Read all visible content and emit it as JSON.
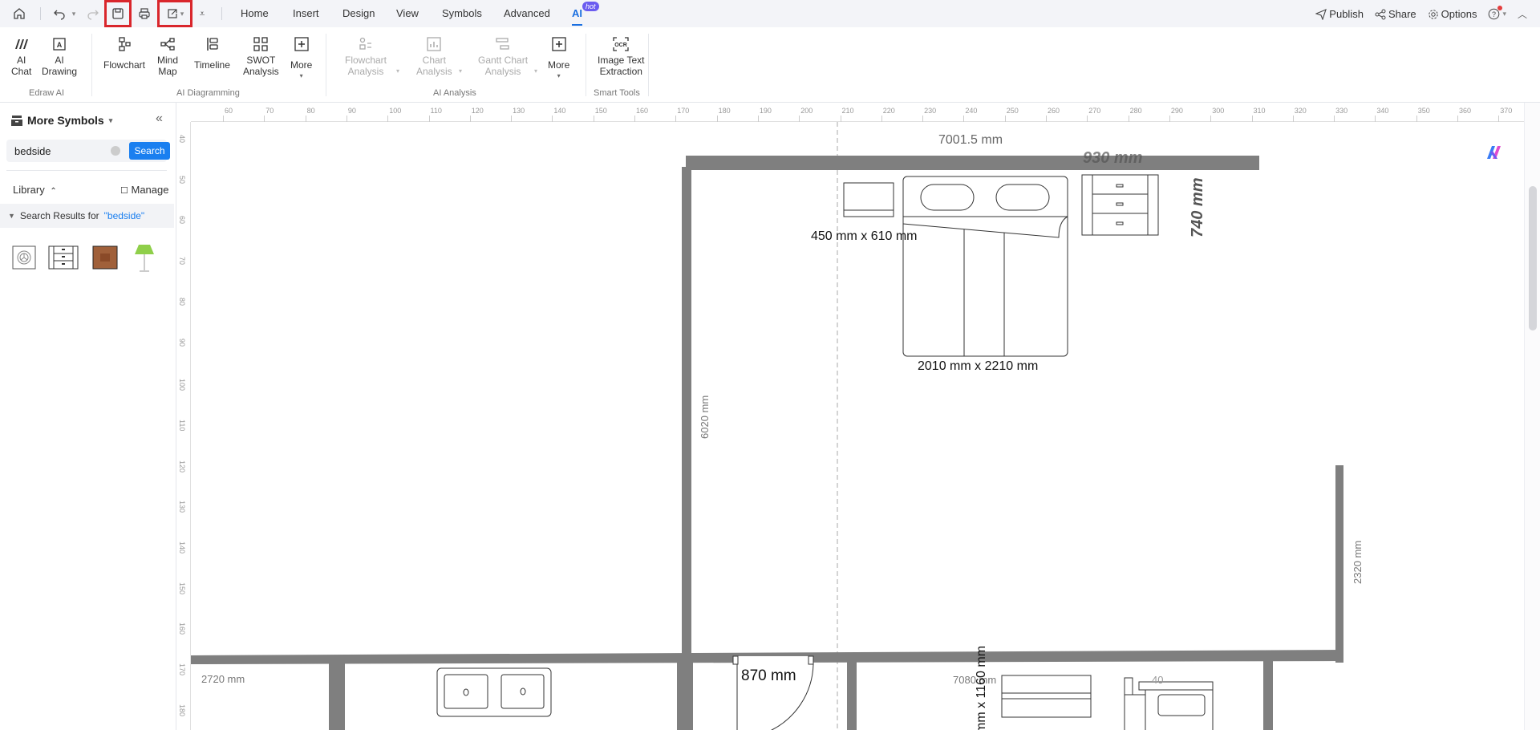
{
  "toolbar": {
    "icons": [
      "home-icon",
      "undo-icon",
      "redo-icon",
      "save-icon",
      "print-icon",
      "export-icon",
      "customize-icon"
    ],
    "tabs": [
      {
        "label": "Home"
      },
      {
        "label": "Insert"
      },
      {
        "label": "Design"
      },
      {
        "label": "View"
      },
      {
        "label": "Symbols"
      },
      {
        "label": "Advanced"
      },
      {
        "label": "AI",
        "active": true
      }
    ],
    "hot_badge": "hot",
    "right": {
      "publish": "Publish",
      "share": "Share",
      "options": "Options"
    }
  },
  "ribbon": {
    "edraw_ai": {
      "group": "Edraw AI",
      "ai_chat": [
        "AI",
        "Chat"
      ],
      "ai_drawing": [
        "AI",
        "Drawing"
      ]
    },
    "ai_diagramming": {
      "group": "AI Diagramming",
      "flowchart": "Flowchart",
      "mind_map": [
        "Mind",
        "Map"
      ],
      "timeline": "Timeline",
      "swot": [
        "SWOT",
        "Analysis"
      ],
      "more": "More"
    },
    "ai_analysis": {
      "group": "AI Analysis",
      "flowchart_analysis": [
        "Flowchart",
        "Analysis"
      ],
      "chart_analysis": [
        "Chart",
        "Analysis"
      ],
      "gantt_analysis": [
        "Gantt Chart",
        "Analysis"
      ],
      "more": "More"
    },
    "smart_tools": {
      "group": "Smart Tools",
      "image_text": [
        "Image Text",
        "Extraction"
      ]
    }
  },
  "sidebar": {
    "title": "More Symbols",
    "search_value": "bedside",
    "search_button": "Search",
    "library": "Library",
    "manage": "Manage",
    "results_prefix": "Search Results for",
    "results_query": "\"bedside\"",
    "symbols": [
      "bedside-table-round-symbol",
      "bedside-drawer-symbol",
      "bedside-table-wood-symbol",
      "bedside-lamp-symbol"
    ]
  },
  "rulers": {
    "horizontal": [
      "60",
      "70",
      "80",
      "90",
      "100",
      "110",
      "120",
      "130",
      "140",
      "150",
      "160",
      "170",
      "180",
      "190",
      "200",
      "210",
      "220",
      "230",
      "240",
      "250",
      "260",
      "270",
      "280",
      "290",
      "300",
      "310",
      "320",
      "330",
      "340",
      "350",
      "360",
      "370"
    ],
    "vertical": [
      "40",
      "50",
      "60",
      "70",
      "80",
      "90",
      "100",
      "110",
      "120",
      "130",
      "140",
      "150",
      "160",
      "170",
      "180"
    ]
  },
  "floorplan": {
    "dim_top": "7001.5 mm",
    "dim_930": "930 mm",
    "dim_740": "740 mm",
    "nightstand": "450 mm x 610 mm",
    "bed": "2010 mm x 2210 mm",
    "dim_6020": "6020 mm",
    "dim_2320": "2320 mm",
    "dim_2720": "2720 mm",
    "door": "870 mm",
    "dim_7080": "7080 mm",
    "dim_1160": "mm x 1160 mm",
    "dim_40": "40"
  }
}
